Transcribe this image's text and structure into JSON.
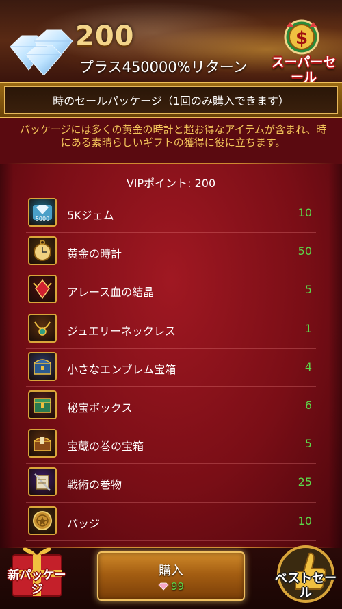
{
  "banner": {
    "gem_count": "200",
    "bonus_text": "プラス450000%リターン",
    "super_sale_label": "スーパーセール"
  },
  "title": "時のセールパッケージ（1回のみ購入できます）",
  "description": "パッケージには多くの黄金の時計と超お得なアイテムが含まれ、時にある素晴らしいギフトの獲得に役に立ちます。",
  "vip_points": "VIPポイント: 200",
  "items": [
    {
      "name": "5Kジェム",
      "qty": "10",
      "icon": "gem-pack-icon"
    },
    {
      "name": "黄金の時計",
      "qty": "50",
      "icon": "pocket-watch-icon"
    },
    {
      "name": "アレース血の結晶",
      "qty": "5",
      "icon": "blood-crystal-icon"
    },
    {
      "name": "ジュエリーネックレス",
      "qty": "1",
      "icon": "necklace-icon"
    },
    {
      "name": "小さなエンブレム宝箱",
      "qty": "4",
      "icon": "emblem-chest-icon"
    },
    {
      "name": "秘宝ボックス",
      "qty": "6",
      "icon": "treasure-box-icon"
    },
    {
      "name": "宝蔵の巻の宝箱",
      "qty": "5",
      "icon": "scroll-chest-icon"
    },
    {
      "name": "戦術の巻物",
      "qty": "25",
      "icon": "tactics-scroll-icon"
    },
    {
      "name": "バッジ",
      "qty": "10",
      "icon": "badge-icon"
    }
  ],
  "footer": {
    "new_package_label": "新パッケージ",
    "buy_label": "購入",
    "price": "99",
    "best_sale_label": "ベストセール"
  },
  "colors": {
    "gold_text": "#f3c45a",
    "qty_green": "#5cd84a",
    "panel_red": "#8a1018"
  }
}
